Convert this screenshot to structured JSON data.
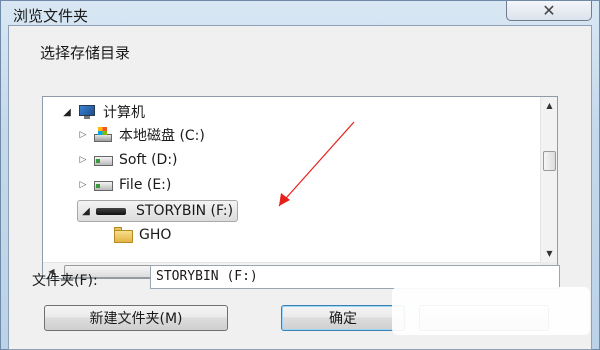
{
  "window": {
    "title": "浏览文件夹",
    "close_glyph": "✕"
  },
  "instruction": "选择存储目录",
  "tree": {
    "items": [
      {
        "label": "计算机",
        "expander": "◢",
        "icon": "computer-icon"
      },
      {
        "label": "本地磁盘 (C:)",
        "expander": "▷",
        "icon": "windows-drive-icon"
      },
      {
        "label": "Soft (D:)",
        "expander": "▷",
        "icon": "drive-icon"
      },
      {
        "label": "File (E:)",
        "expander": "▷",
        "icon": "drive-icon"
      },
      {
        "label": "STORYBIN (F:)",
        "expander": "◢",
        "icon": "usb-drive-icon",
        "selected": true
      },
      {
        "label": "GHO",
        "expander": "",
        "icon": "folder-icon"
      }
    ],
    "scroll_up": "▲",
    "scroll_down": "▼",
    "scroll_left": "◀",
    "scroll_right": "▶",
    "thumb_grip": "|||"
  },
  "folder_field": {
    "label": "文件夹(F):",
    "value": "STORYBIN (F:)"
  },
  "buttons": {
    "new_folder": "新建文件夹(M)",
    "ok": "确定",
    "cancel": ""
  },
  "annotation_color": "#e8201a"
}
